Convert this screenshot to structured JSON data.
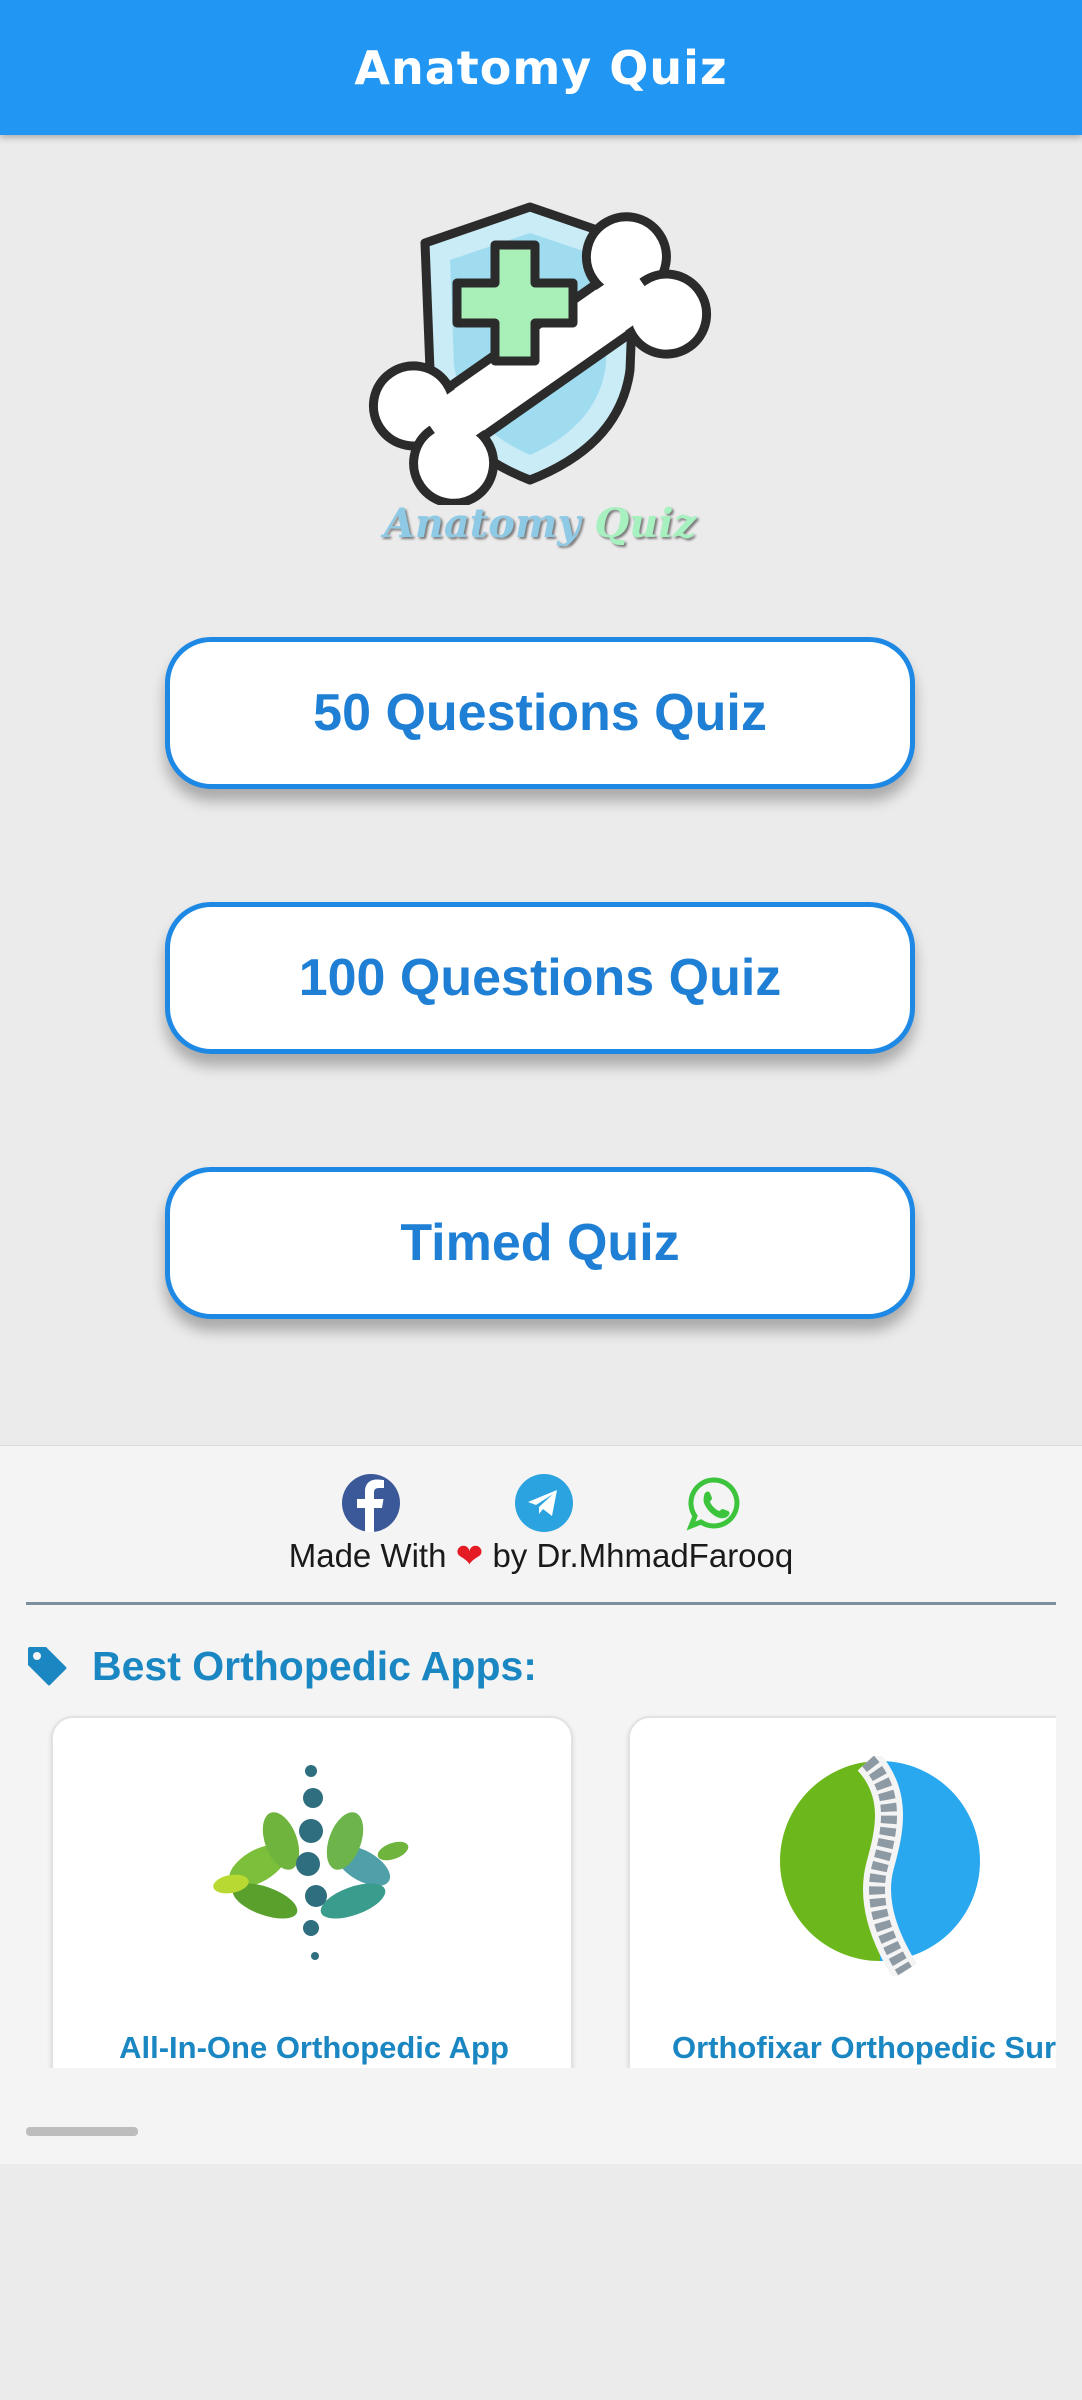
{
  "appbar": {
    "title": "Anatomy Quiz"
  },
  "logo": {
    "word1": "Anatomy",
    "word2": "Quiz"
  },
  "buttons": {
    "quiz50": "50 Questions Quiz",
    "quiz100": "100 Questions Quiz",
    "timed": "Timed Quiz"
  },
  "footer": {
    "social": [
      "facebook-icon",
      "telegram-icon",
      "whatsapp-icon"
    ],
    "made_with": "Made With",
    "heart": "❤",
    "by": "by Dr.MhmadFarooq",
    "section_title": "Best Orthopedic Apps:",
    "apps": [
      {
        "label": "All-In-One Orthopedic App"
      },
      {
        "label": "Orthofixar Orthopedic Surg"
      }
    ]
  },
  "colors": {
    "primary": "#2196f3",
    "button_border": "#1e88e5",
    "button_text": "#1e7fd4",
    "section_text": "#1a86c2",
    "heart": "#e51c23"
  }
}
